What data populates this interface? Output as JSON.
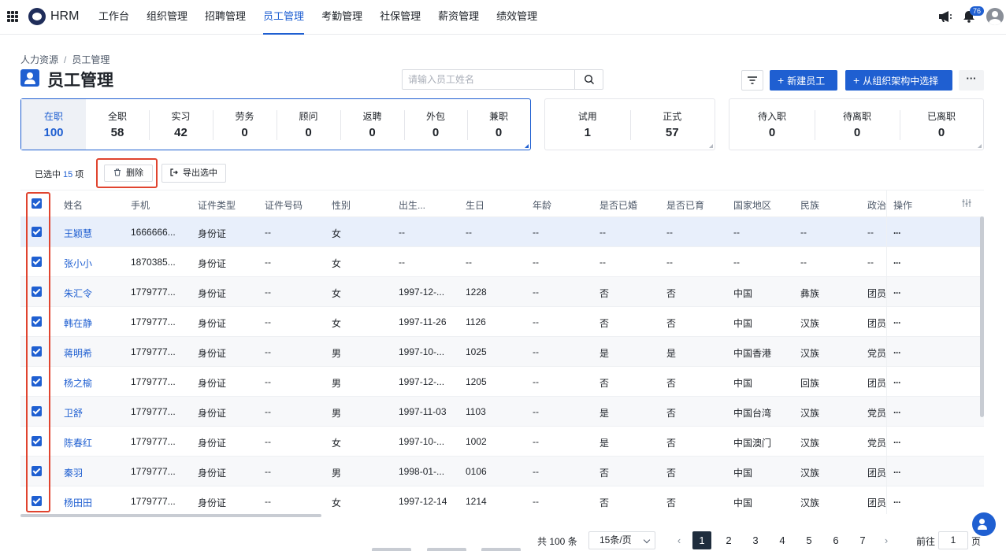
{
  "app": {
    "brand": "HRM"
  },
  "nav": {
    "items": [
      {
        "label": "工作台",
        "active": false
      },
      {
        "label": "组织管理",
        "active": false
      },
      {
        "label": "招聘管理",
        "active": false
      },
      {
        "label": "员工管理",
        "active": true
      },
      {
        "label": "考勤管理",
        "active": false
      },
      {
        "label": "社保管理",
        "active": false
      },
      {
        "label": "薪资管理",
        "active": false
      },
      {
        "label": "绩效管理",
        "active": false
      }
    ],
    "notification_count": "76"
  },
  "breadcrumb": [
    "人力资源",
    "员工管理"
  ],
  "page_title": "员工管理",
  "search": {
    "placeholder": "请输入员工姓名",
    "value": ""
  },
  "actions": {
    "new_employee": "新建员工",
    "select_from_org": "从组织架构中选择",
    "more": "···"
  },
  "stats_main": [
    {
      "label": "在职",
      "value": "100",
      "selected": true
    },
    {
      "label": "全职",
      "value": "58"
    },
    {
      "label": "实习",
      "value": "42"
    },
    {
      "label": "劳务",
      "value": "0"
    },
    {
      "label": "顾问",
      "value": "0"
    },
    {
      "label": "返聘",
      "value": "0"
    },
    {
      "label": "外包",
      "value": "0"
    },
    {
      "label": "兼职",
      "value": "0"
    }
  ],
  "stats_probation": [
    {
      "label": "试用",
      "value": "1"
    },
    {
      "label": "正式",
      "value": "57"
    }
  ],
  "stats_status": [
    {
      "label": "待入职",
      "value": "0"
    },
    {
      "label": "待离职",
      "value": "0"
    },
    {
      "label": "已离职",
      "value": "0"
    }
  ],
  "selection": {
    "prefix": "已选中",
    "count": "15",
    "suffix": "项",
    "delete_label": "删除",
    "export_label": "导出选中"
  },
  "table": {
    "columns": [
      "姓名",
      "手机",
      "证件类型",
      "证件号码",
      "性别",
      "出生...",
      "生日",
      "年龄",
      "是否已婚",
      "是否已育",
      "国家地区",
      "民族",
      "政治",
      "操作"
    ],
    "rows": [
      [
        "王颖慧",
        "1666666...",
        "身份证",
        "--",
        "女",
        "--",
        "--",
        "--",
        "--",
        "--",
        "--",
        "--",
        "--"
      ],
      [
        "张小小",
        "1870385...",
        "身份证",
        "--",
        "女",
        "--",
        "--",
        "--",
        "--",
        "--",
        "--",
        "--",
        "--"
      ],
      [
        "朱汇令",
        "1779777...",
        "身份证",
        "--",
        "女",
        "1997-12-...",
        "1228",
        "--",
        "否",
        "否",
        "中国",
        "彝族",
        "团员"
      ],
      [
        "韩在静",
        "1779777...",
        "身份证",
        "--",
        "女",
        "1997-11-26",
        "1126",
        "--",
        "否",
        "否",
        "中国",
        "汉族",
        "团员"
      ],
      [
        "蒋明希",
        "1779777...",
        "身份证",
        "--",
        "男",
        "1997-10-...",
        "1025",
        "--",
        "是",
        "是",
        "中国香港",
        "汉族",
        "党员"
      ],
      [
        "杨之榆",
        "1779777...",
        "身份证",
        "--",
        "男",
        "1997-12-...",
        "1205",
        "--",
        "否",
        "否",
        "中国",
        "回族",
        "团员"
      ],
      [
        "卫舒",
        "1779777...",
        "身份证",
        "--",
        "男",
        "1997-11-03",
        "1103",
        "--",
        "是",
        "否",
        "中国台湾",
        "汉族",
        "党员"
      ],
      [
        "陈春红",
        "1779777...",
        "身份证",
        "--",
        "女",
        "1997-10-...",
        "1002",
        "--",
        "是",
        "否",
        "中国澳门",
        "汉族",
        "党员"
      ],
      [
        "秦羽",
        "1779777...",
        "身份证",
        "--",
        "男",
        "1998-01-...",
        "0106",
        "--",
        "否",
        "否",
        "中国",
        "汉族",
        "团员"
      ],
      [
        "杨田田",
        "1779777...",
        "身份证",
        "--",
        "女",
        "1997-12-14",
        "1214",
        "--",
        "否",
        "否",
        "中国",
        "汉族",
        "团员"
      ]
    ]
  },
  "pagination": {
    "total": "共 100 条",
    "page_size": "15条/页",
    "pages": [
      "1",
      "2",
      "3",
      "4",
      "5",
      "6",
      "7"
    ],
    "current": "1",
    "goto_label": "前往",
    "goto_value": "1",
    "goto_unit": "页"
  },
  "colors": {
    "accent": "#1f5fd1",
    "highlight": "#e0442f"
  }
}
